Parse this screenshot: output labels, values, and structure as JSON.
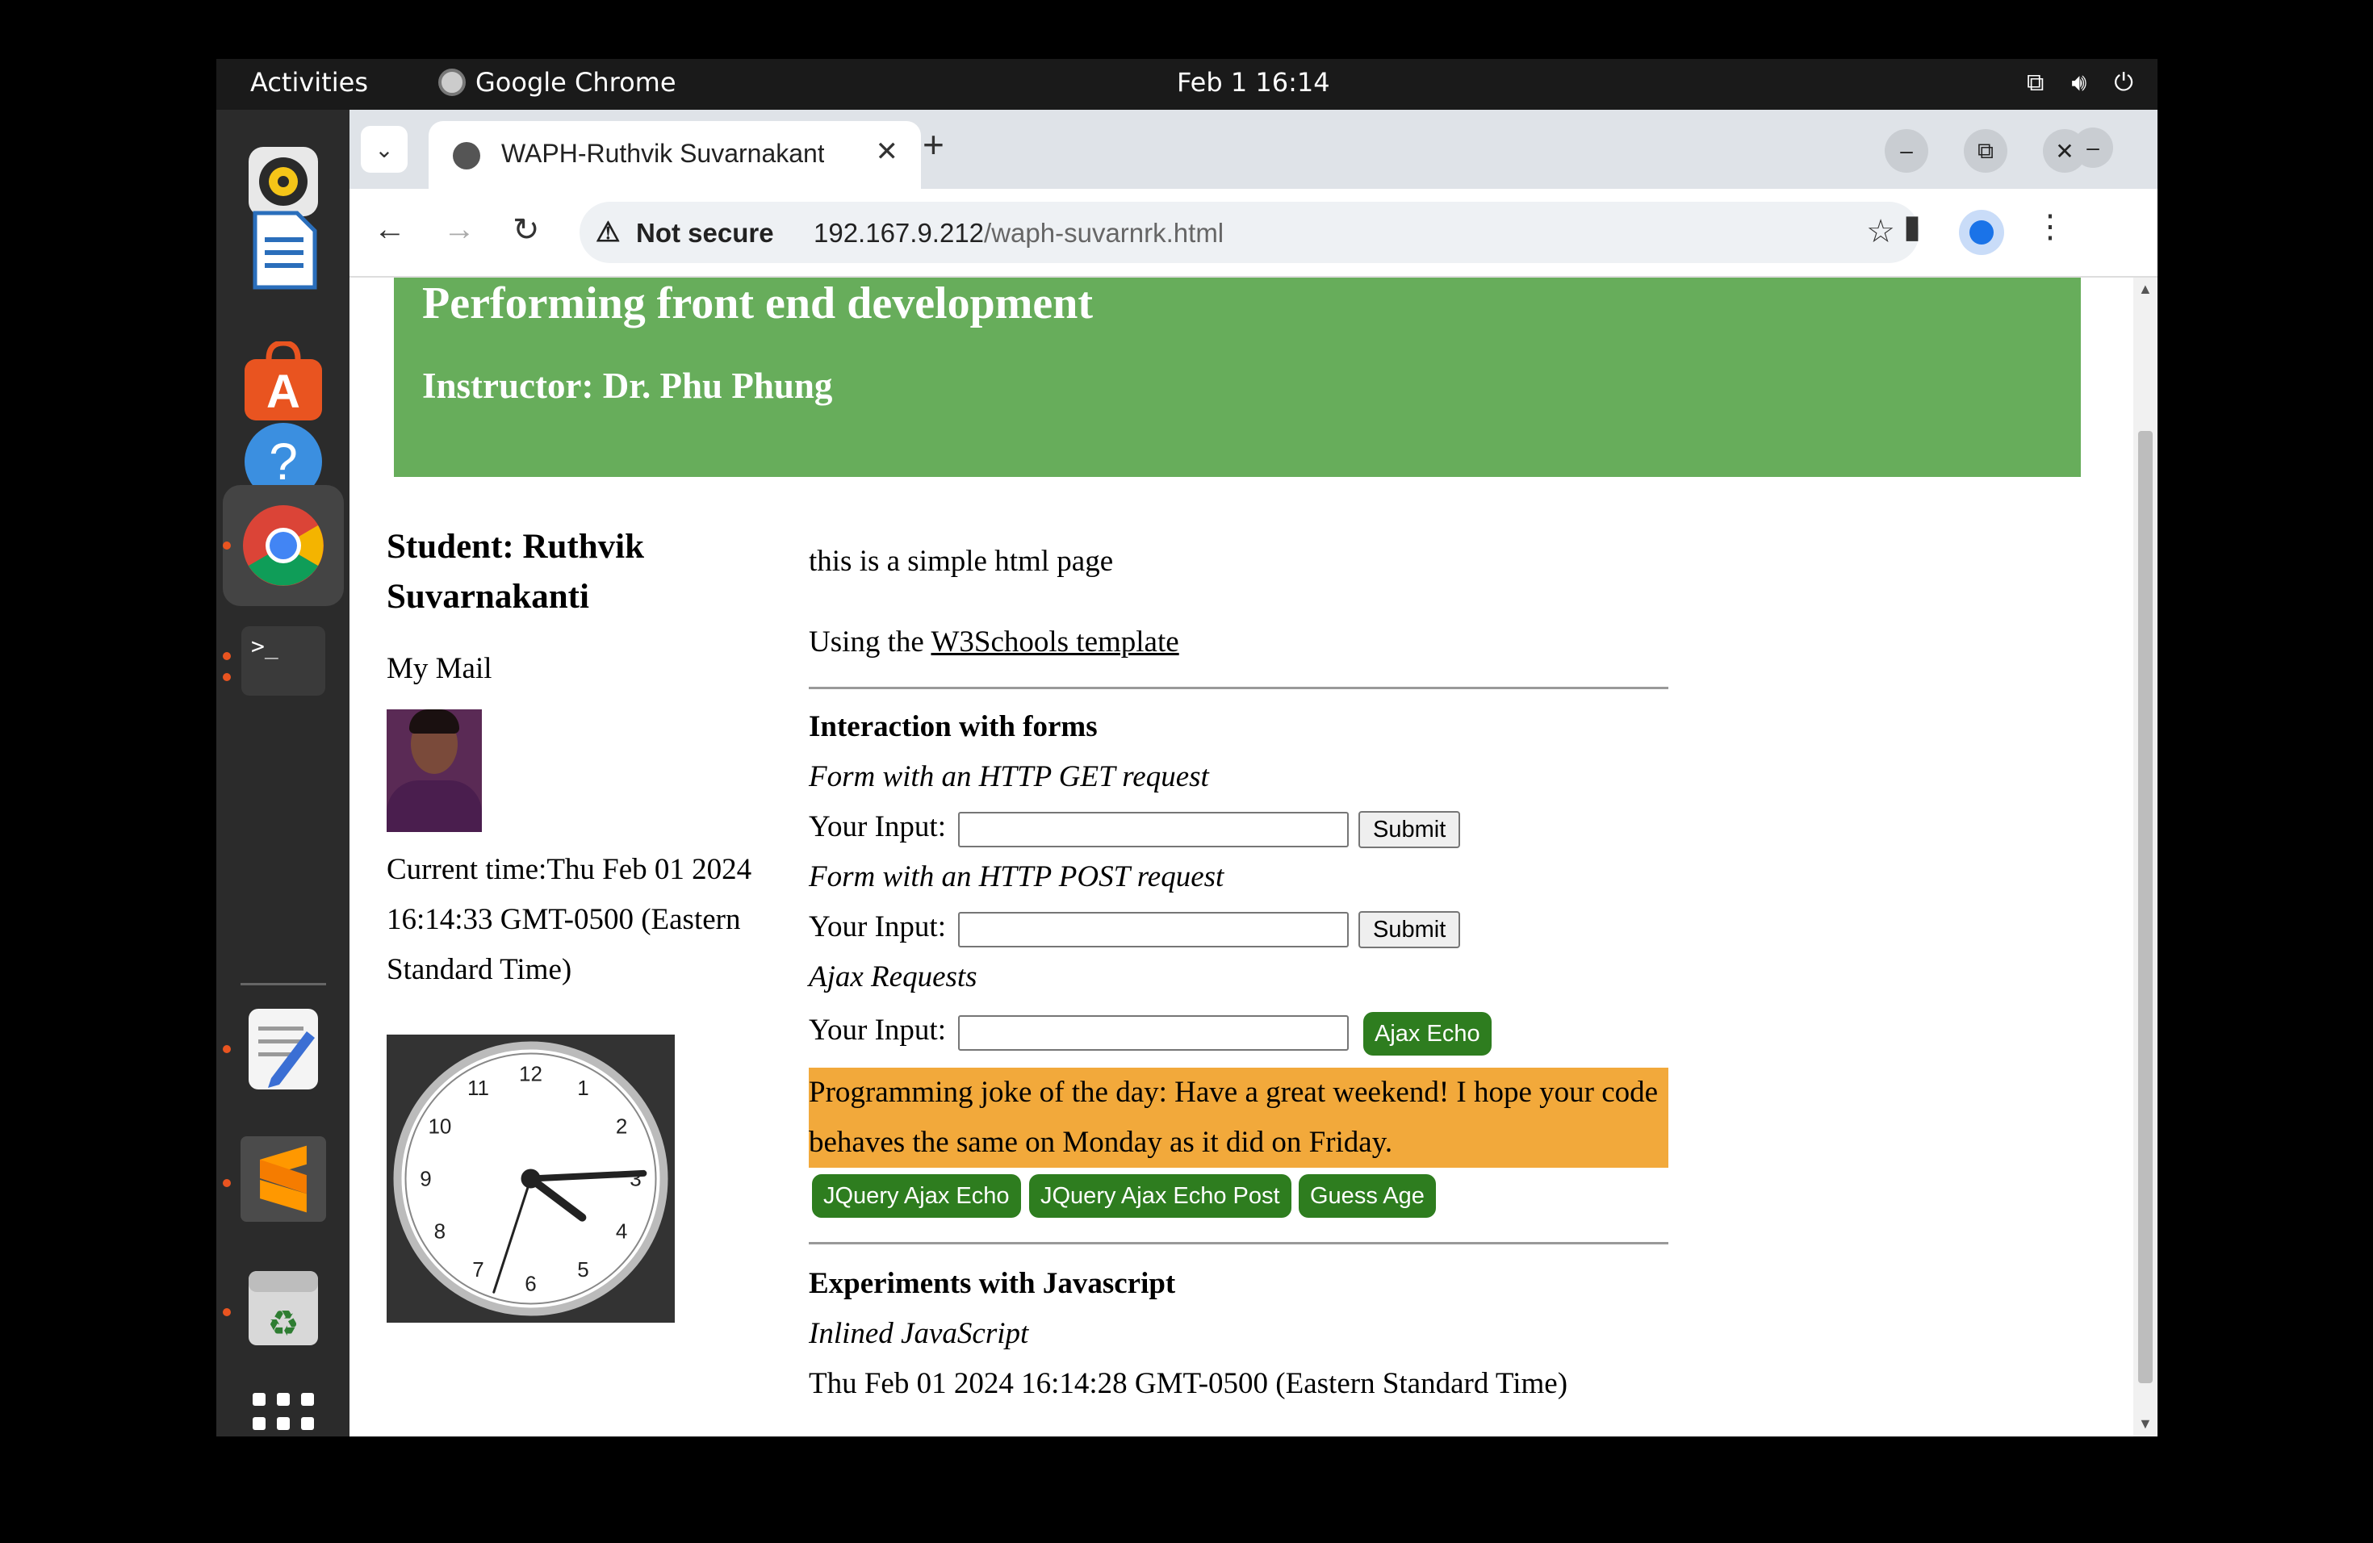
{
  "topbar": {
    "activities": "Activities",
    "app_name": "Google Chrome",
    "datetime": "Feb 1  16:14"
  },
  "dock": {
    "items": [
      "rhythmbox-icon",
      "libreoffice-writer-icon",
      "app-center-icon",
      "help-icon",
      "chrome-icon",
      "terminal-icon",
      "text-editor-icon",
      "sublime-text-icon",
      "trash-icon",
      "show-apps-icon"
    ]
  },
  "browser": {
    "tab_title": "WAPH-Ruthvik Suvarnakanti",
    "security_label": "Not secure",
    "url_host": "192.167.9.212",
    "url_path": "/waph-suvarnrk.html"
  },
  "page": {
    "header_title": "Performing front end development",
    "header_instructor": "Instructor: Dr. Phu Phung",
    "student": "Student: Ruthvik Suvarnakanti",
    "my_mail": "My Mail",
    "current_time": "Current time:Thu Feb 01 2024 16:14:33 GMT-0500 (Eastern Standard Time)",
    "intro": "this is a simple html page",
    "using_prefix": "Using the ",
    "w3_link": "W3Schools template",
    "forms_heading": "Interaction with forms",
    "get_heading": "Form with an HTTP GET request",
    "input_label": "Your Input:",
    "submit_label": "Submit",
    "post_heading": "Form with an HTTP POST request",
    "ajax_heading": "Ajax Requests",
    "ajax_echo": "Ajax Echo",
    "joke": "Programming joke of the day: Have a great weekend! I hope your code behaves the same on Monday as it did on Friday.",
    "jquery_echo": "JQuery Ajax Echo",
    "jquery_post": "JQuery Ajax Echo Post",
    "guess_age": "Guess Age",
    "js_heading": "Experiments with Javascript",
    "inline_js": "Inlined JavaScript",
    "inline_date": "Thu Feb 01 2024 16:14:28 GMT-0500 (Eastern Standard Time)"
  },
  "analog_clock": {
    "numbers": [
      "12",
      "1",
      "2",
      "3",
      "4",
      "5",
      "6",
      "7",
      "8",
      "9",
      "10",
      "11"
    ],
    "hour": 16,
    "minute": 14,
    "second": 33
  },
  "colors": {
    "header_bg": "#67ad5b",
    "joke_bg": "#f2a93b",
    "button_green": "#2e7d1f"
  }
}
